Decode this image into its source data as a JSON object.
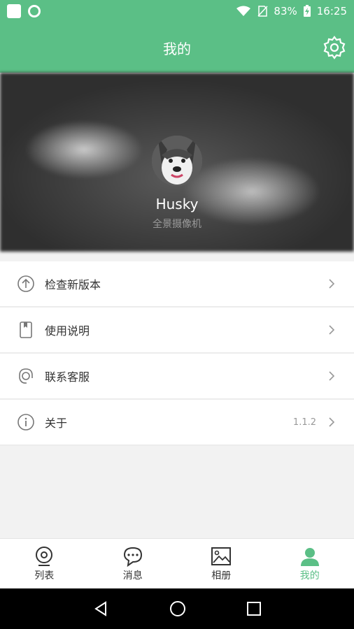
{
  "status_bar": {
    "battery": "83%",
    "time": "16:25"
  },
  "header": {
    "title": "我的",
    "settings_icon": "gear-icon"
  },
  "profile": {
    "name": "Husky",
    "subtitle": "全景摄像机"
  },
  "menu": [
    {
      "label": "检查新版本",
      "icon": "upload-circle-icon",
      "value": ""
    },
    {
      "label": "使用说明",
      "icon": "manual-icon",
      "value": ""
    },
    {
      "label": "联系客服",
      "icon": "customer-service-icon",
      "value": ""
    },
    {
      "label": "关于",
      "icon": "info-icon",
      "value": "1.1.2"
    }
  ],
  "tabs": [
    {
      "label": "列表",
      "icon": "camera-icon"
    },
    {
      "label": "消息",
      "icon": "message-icon"
    },
    {
      "label": "相册",
      "icon": "album-icon"
    },
    {
      "label": "我的",
      "icon": "person-icon"
    }
  ],
  "colors": {
    "primary": "#5bbf86",
    "text": "#333333",
    "muted": "#999999"
  }
}
